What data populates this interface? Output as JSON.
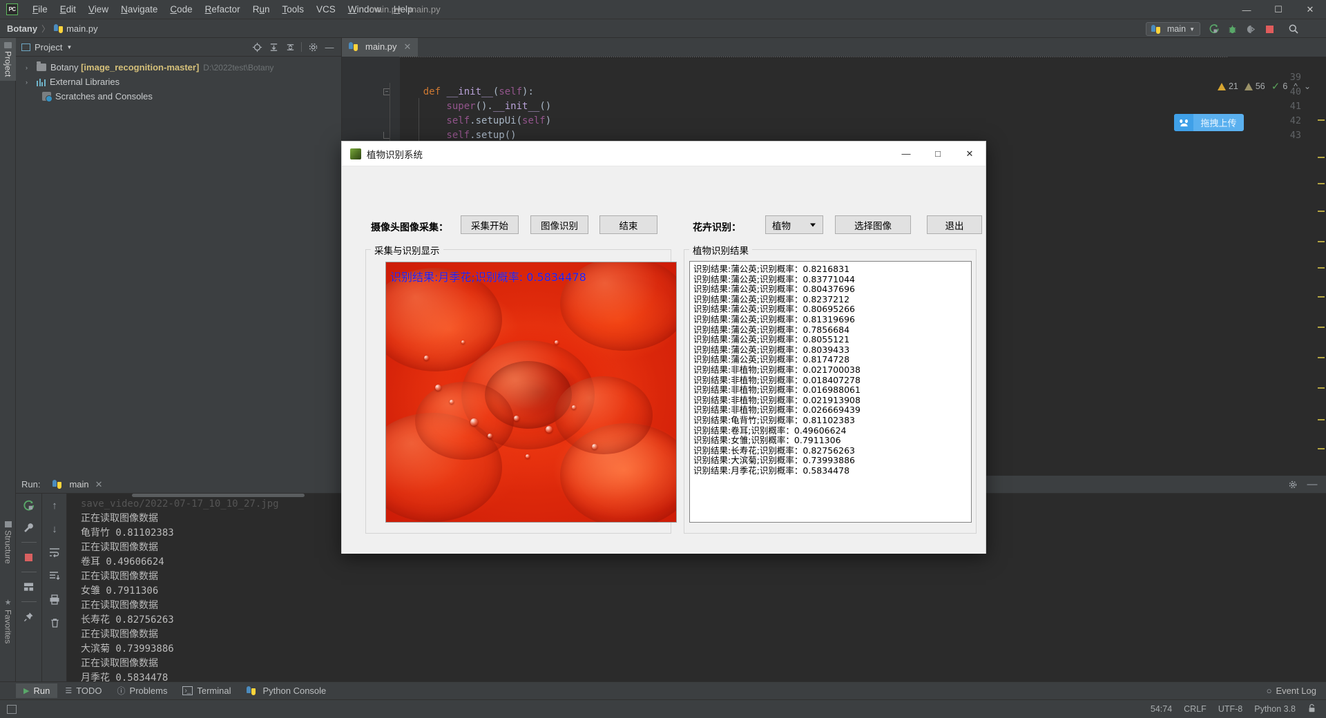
{
  "ide": {
    "window_title": "main.py - main.py",
    "menu": [
      {
        "label": "File"
      },
      {
        "label": "Edit"
      },
      {
        "label": "View"
      },
      {
        "label": "Navigate"
      },
      {
        "label": "Code"
      },
      {
        "label": "Refactor"
      },
      {
        "label": "Run"
      },
      {
        "label": "Tools"
      },
      {
        "label": "VCS"
      },
      {
        "label": "Window"
      },
      {
        "label": "Help"
      }
    ],
    "breadcrumb": {
      "project": "Botany",
      "separator": "〉",
      "file": "main.py"
    },
    "run_config": "main",
    "badges": {
      "warnings_major": "21",
      "warnings_minor": "56",
      "checks": "6"
    },
    "baidu_widget": {
      "label": "拖拽上传",
      "icon": "cloud-icon",
      "color": "#5ab0ef"
    }
  },
  "left_tabs": [
    {
      "label": "Project",
      "active": true
    },
    {
      "label": "Structure",
      "active": false
    },
    {
      "label": "Favorites",
      "active": false
    }
  ],
  "project_panel": {
    "title": "Project",
    "tree": [
      {
        "arrow": "›",
        "icon": "folder-icon",
        "name": "Botany ",
        "bold": "[image_recognition-master]",
        "path": "D:\\2022test\\Botany"
      },
      {
        "arrow": "›",
        "icon": "library-icon",
        "name": "External Libraries",
        "bold": "",
        "path": ""
      },
      {
        "arrow": "",
        "icon": "scratches-icon",
        "name": "Scratches and Consoles",
        "bold": "",
        "path": ""
      }
    ]
  },
  "editor": {
    "tab": "main.py",
    "lines": [
      {
        "num": "39",
        "text": "",
        "fold": false
      },
      {
        "num": "40",
        "text": "    def __init__(self):",
        "fold": true
      },
      {
        "num": "41",
        "text": "        super().__init__()",
        "fold": false
      },
      {
        "num": "42",
        "text": "        self.setupUi(self)",
        "fold": false
      },
      {
        "num": "43",
        "text": "        self.setup()",
        "fold": true
      }
    ]
  },
  "run_panel": {
    "label": "Run:",
    "tab": "main",
    "console_lines": [
      {
        "text": "save_video/2022-07-17_10_10_27.jpg",
        "cut": true
      },
      {
        "text": "正在读取图像数据"
      },
      {
        "text": "龟背竹 0.81102383"
      },
      {
        "text": "正在读取图像数据"
      },
      {
        "text": "卷耳 0.49606624"
      },
      {
        "text": "正在读取图像数据"
      },
      {
        "text": "女雏 0.7911306"
      },
      {
        "text": "正在读取图像数据"
      },
      {
        "text": "长寿花 0.82756263"
      },
      {
        "text": "正在读取图像数据"
      },
      {
        "text": "大滨菊 0.73993886"
      },
      {
        "text": "正在读取图像数据"
      },
      {
        "text": "月季花 0.5834478"
      }
    ]
  },
  "bottom_bar": {
    "items": [
      {
        "label": "Run",
        "icon": "run-icon",
        "active": true
      },
      {
        "label": "TODO",
        "icon": "todo-icon",
        "active": false
      },
      {
        "label": "Problems",
        "icon": "problems-icon",
        "active": false
      },
      {
        "label": "Terminal",
        "icon": "terminal-icon",
        "active": false
      },
      {
        "label": "Python Console",
        "icon": "python-icon",
        "active": false
      }
    ],
    "event_log": "Event Log"
  },
  "status_bar": {
    "caret": "54:74",
    "line_separator": "CRLF",
    "encoding": "UTF-8",
    "interpreter": "Python 3.8",
    "lock": "lock-icon"
  },
  "dialog": {
    "title": "植物识别系统",
    "controls": {
      "minimize": "—",
      "maximize": "□",
      "close": "✕"
    },
    "toolbar": {
      "camera_label": "摄像头图像采集：",
      "btn_start": "采集开始",
      "btn_recognize": "图像识别",
      "btn_end": "结束",
      "flower_label": "花卉识别：",
      "combo_value": "植物",
      "btn_choose_image": "选择图像",
      "btn_exit": "退出"
    },
    "left_group_title": "采集与识别显示",
    "right_group_title": "植物识别结果",
    "image_overlay": "识别结果:月季花;识别概率: 0.5834478",
    "image_alt": "red-rose-photo",
    "results": [
      "识别结果:蒲公英;识别概率：0.8216831",
      "识别结果:蒲公英;识别概率：0.83771044",
      "识别结果:蒲公英;识别概率：0.80437696",
      "识别结果:蒲公英;识别概率：0.8237212",
      "识别结果:蒲公英;识别概率：0.80695266",
      "识别结果:蒲公英;识别概率：0.81319696",
      "识别结果:蒲公英;识别概率：0.7856684",
      "识别结果:蒲公英;识别概率：0.8055121",
      "识别结果:蒲公英;识别概率：0.8039433",
      "识别结果:蒲公英;识别概率：0.8174728",
      "识别结果:非植物;识别概率：0.021700038",
      "识别结果:非植物;识别概率：0.018407278",
      "识别结果:非植物;识别概率：0.016988061",
      "识别结果:非植物;识别概率：0.021913908",
      "识别结果:非植物;识别概率：0.026669439",
      "识别结果:龟背竹;识别概率：0.81102383",
      "识别结果:卷耳;识别概率：0.49606624",
      "识别结果:女雏;识别概率：0.7911306",
      "识别结果:长寿花;识别概率：0.82756263",
      "识别结果:大滨菊;识别概率：0.73993886",
      "识别结果:月季花;识别概率：0.5834478"
    ]
  }
}
